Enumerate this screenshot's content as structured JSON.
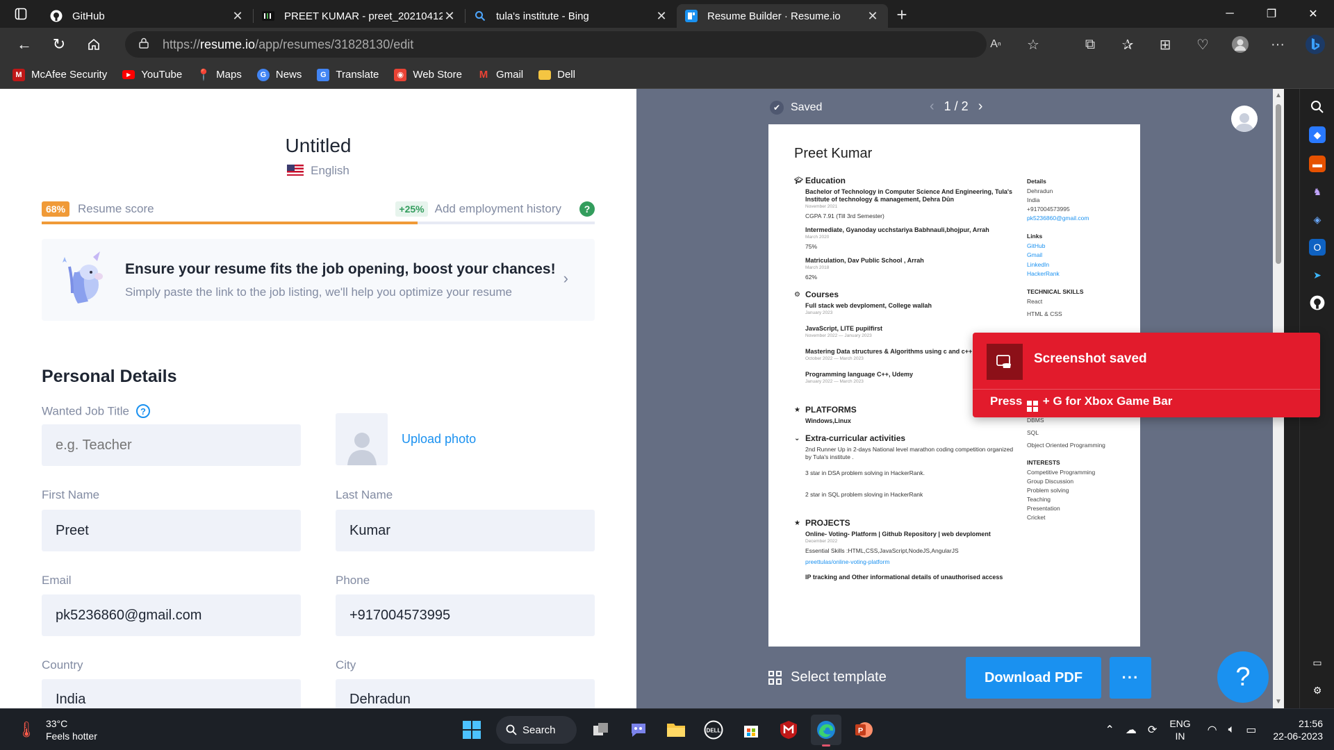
{
  "browser": {
    "tabs": [
      {
        "title": "GitHub",
        "icon": "github-icon"
      },
      {
        "title": "PREET KUMAR - preet_20210412",
        "icon": "naukri-icon"
      },
      {
        "title": "tula's institute - Bing",
        "icon": "bing-search-icon"
      },
      {
        "title": "Resume Builder · Resume.io",
        "icon": "resumeio-icon"
      }
    ],
    "address": {
      "scheme": "https://",
      "host": "resume.io",
      "path": "/app/resumes/31828130/edit"
    },
    "bookmarks": [
      {
        "label": "McAfee Security",
        "icon": "mcafee-icon",
        "color": "#c01818"
      },
      {
        "label": "YouTube",
        "icon": "youtube-icon",
        "color": "#ff0000"
      },
      {
        "label": "Maps",
        "icon": "maps-icon",
        "color": "#34a853"
      },
      {
        "label": "News",
        "icon": "news-icon",
        "color": "#4285f4"
      },
      {
        "label": "Translate",
        "icon": "translate-icon",
        "color": "#4285f4"
      },
      {
        "label": "Web Store",
        "icon": "webstore-icon",
        "color": "#e94335"
      },
      {
        "label": "Gmail",
        "icon": "gmail-icon",
        "color": "#ea4335"
      },
      {
        "label": "Dell",
        "icon": "folder-icon",
        "color": "#f4c542"
      }
    ]
  },
  "editor": {
    "title": "Untitled",
    "language": "English",
    "score": {
      "badge": "68%",
      "label": "Resume score",
      "progress": 0.68,
      "tip_badge": "+25%",
      "tip_text": "Add employment history",
      "help": "?"
    },
    "boost": {
      "title": "Ensure your resume fits the job opening, boost your chances!",
      "subtitle": "Simply paste the link to the job listing, we'll help you optimize your resume",
      "chevron": "›"
    },
    "personal": {
      "section_title": "Personal Details",
      "job_title_label": "Wanted Job Title",
      "job_title_placeholder": "e.g. Teacher",
      "upload_photo": "Upload photo",
      "first_name_label": "First Name",
      "first_name": "Preet",
      "last_name_label": "Last Name",
      "last_name": "Kumar",
      "email_label": "Email",
      "email": "pk5236860@gmail.com",
      "phone_label": "Phone",
      "phone": "+917004573995",
      "country_label": "Country",
      "country": "India",
      "city_label": "City",
      "city": "Dehradun"
    }
  },
  "preview": {
    "saved": "Saved",
    "page": "1 / 2",
    "select_template": "Select template",
    "download": "Download PDF",
    "more": "···",
    "help": "?",
    "resume": {
      "name": "Preet Kumar",
      "education_h": "Education",
      "edu1_t": "Bachelor of Technology in Computer Science And Engineering, Tula's Institute of technology & management, Dehra Dūn",
      "edu1_d": "November 2021",
      "edu1_x": "CGPA 7.91 (Till 3rd Semester)",
      "edu2_t": "Intermediate, Gyanoday ucchstariya Babhnauli,bhojpur, Arrah",
      "edu2_d": "March 2020",
      "edu2_x": "75%",
      "edu3_t": "Matriculation, Dav Public School , Arrah",
      "edu3_d": "March 2018",
      "edu3_x": "62%",
      "courses_h": "Courses",
      "c1_t": "Full stack web devploment, College wallah",
      "c1_d": "January 2023",
      "c2_t": "JavaScript, LITE pupilfirst",
      "c2_d": "November 2022 — January 2023",
      "c3_t": "Mastering Data structures & Algorithms using c and c++",
      "c3_d": "October 2022 — March 2023",
      "c4_t": "Programming language C++, Udemy",
      "c4_d": "January 2022 — March 2023",
      "platforms_h": "PLATFORMS",
      "platforms_t": "Windows,Linux",
      "extra_h": "Extra-curricular activities",
      "e1": "2nd Runner Up in 2-days National level marathon coding competition organized by Tula's institute .",
      "e2": "3 star in DSA  problem solving in HackerRank.",
      "e3": "2 star in SQL problem sloving in HackerRank",
      "projects_h": "PROJECTS",
      "p1_t": "Online- Voting- Platform | Github Repository | web devploment",
      "p1_d": "December 2022",
      "p1_x": "Essential Skills :HTML,CSS,JavaScript,NodeJS,AngularJS",
      "p1_l": "preettulas/online-voting-platform",
      "p2_t": "IP tracking and Other informational details of unauthorised access",
      "details_h": "Details",
      "d1": "Dehradun",
      "d2": "India",
      "d3": "+917004573995",
      "d4": "pk5236860@gmail.com",
      "links_h": "Links",
      "l1": "GitHub",
      "l2": "Gmail",
      "l3": "LinkedIn",
      "l4": "HackerRank",
      "skills_h": "TECHNICAL SKILLS",
      "s1": "React",
      "s2": "HTML & CSS",
      "s3": "DBMS",
      "s4": "SQL",
      "s5": "Object Oriented Programming",
      "interests_h": "INTERESTS",
      "i1": "Competitive Programming",
      "i2": "Group Discussion",
      "i3": "Problem solving",
      "i4": "Teaching",
      "i5": "Presentation",
      "i6": "Cricket"
    }
  },
  "toast": {
    "title": "Screenshot saved",
    "sub_prefix": "Press",
    "sub_suffix": "+ G for Xbox Game Bar"
  },
  "taskbar": {
    "temp": "33°C",
    "weather_note": "Feels hotter",
    "search": "Search",
    "lang1": "ENG",
    "lang2": "IN",
    "time": "21:56",
    "date": "22-06-2023"
  }
}
